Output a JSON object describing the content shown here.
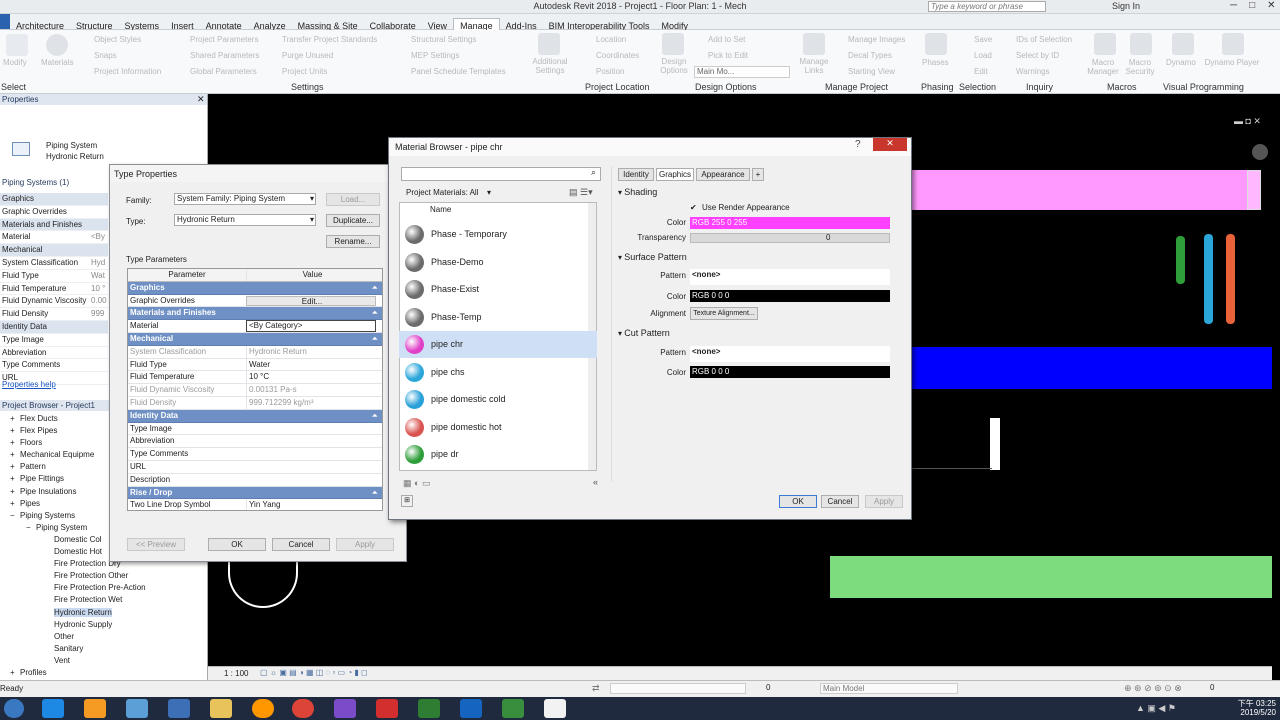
{
  "window": {
    "title": "Autodesk Revit 2018 -   Project1 - Floor Plan: 1 - Mech",
    "search_placeholder": "Type a keyword or phrase",
    "sign_in": "Sign In"
  },
  "ribbon": {
    "tabs": [
      "Architecture",
      "Structure",
      "Systems",
      "Insert",
      "Annotate",
      "Analyze",
      "Massing & Site",
      "Collaborate",
      "View",
      "Manage",
      "Add-Ins",
      "BIM Interoperability Tools",
      "Modify"
    ],
    "active_tab": "Manage",
    "modify_label": "Modify",
    "materials_label": "Materials",
    "settings_items": [
      "Object Styles",
      "Snaps",
      "Project Information",
      "Project Parameters",
      "Shared Parameters",
      "Global Parameters",
      "Transfer Project Standards",
      "Purge Unused",
      "Project Units",
      "Structural Settings",
      "MEP Settings",
      "Panel Schedule Templates"
    ],
    "additional_settings": "Additional Settings",
    "location_items": [
      "Location",
      "Coordinates",
      "Position"
    ],
    "design_options_items": [
      "Add to Set",
      "Pick to Edit",
      "Main Mo..."
    ],
    "design_options_label": "Design Options",
    "manage_project_items": [
      "Manage Images",
      "Decal Types",
      "Starting View"
    ],
    "manage_links": "Manage Links",
    "phases": "Phases",
    "selection_items": [
      "Save",
      "Load",
      "Edit"
    ],
    "inquiry_items": [
      "IDs of Selection",
      "Select by ID",
      "Warnings"
    ],
    "macros_items": [
      "Macro Manager",
      "Macro Security"
    ],
    "dynamo_items": [
      "Dynamo",
      "Dynamo Player"
    ],
    "groups": [
      "Select",
      "Settings",
      "Project Location",
      "Design Options",
      "Manage Project",
      "Phasing",
      "Selection",
      "Inquiry",
      "Macros",
      "Visual Programming"
    ]
  },
  "properties": {
    "header": "Properties",
    "type_line1": "Piping System",
    "type_line2": "Hydronic Return",
    "filter": "Piping Systems (1)",
    "rows": [
      {
        "k": "Graphics",
        "v": "",
        "sec": true
      },
      {
        "k": "Graphic Overrides",
        "v": "",
        "sec": false
      },
      {
        "k": "Materials and Finishes",
        "v": "",
        "sec": true
      },
      {
        "k": "Material",
        "v": "<By",
        "sec": false
      },
      {
        "k": "Mechanical",
        "v": "",
        "sec": true
      },
      {
        "k": "System Classification",
        "v": "Hyd",
        "sec": false
      },
      {
        "k": "Fluid Type",
        "v": "Wat",
        "sec": false
      },
      {
        "k": "Fluid Temperature",
        "v": "10 °",
        "sec": false
      },
      {
        "k": "Fluid Dynamic Viscosity",
        "v": "0.00",
        "sec": false
      },
      {
        "k": "Fluid Density",
        "v": "999",
        "sec": false
      },
      {
        "k": "Identity Data",
        "v": "",
        "sec": true
      },
      {
        "k": "Type Image",
        "v": "",
        "sec": false
      },
      {
        "k": "Abbreviation",
        "v": "",
        "sec": false
      },
      {
        "k": "Type Comments",
        "v": "",
        "sec": false
      },
      {
        "k": "URL",
        "v": "",
        "sec": false
      }
    ],
    "help": "Properties help"
  },
  "project_browser": {
    "header": "Project Browser - Project1",
    "items": [
      {
        "label": "Flex Ducts",
        "level": 1,
        "expander": "+"
      },
      {
        "label": "Flex Pipes",
        "level": 1,
        "expander": "+"
      },
      {
        "label": "Floors",
        "level": 1,
        "expander": "+"
      },
      {
        "label": "Mechanical Equipme",
        "level": 1,
        "expander": "+"
      },
      {
        "label": "Pattern",
        "level": 1,
        "expander": "+"
      },
      {
        "label": "Pipe Fittings",
        "level": 1,
        "expander": "+"
      },
      {
        "label": "Pipe Insulations",
        "level": 1,
        "expander": "+"
      },
      {
        "label": "Pipes",
        "level": 1,
        "expander": "+"
      },
      {
        "label": "Piping Systems",
        "level": 1,
        "expander": "−"
      },
      {
        "label": "Piping System",
        "level": 2,
        "expander": "−"
      },
      {
        "label": "Domestic Col",
        "level": 3,
        "expander": ""
      },
      {
        "label": "Domestic Hot",
        "level": 3,
        "expander": ""
      },
      {
        "label": "Fire Protection Dry",
        "level": 3,
        "expander": ""
      },
      {
        "label": "Fire Protection Other",
        "level": 3,
        "expander": ""
      },
      {
        "label": "Fire Protection Pre-Action",
        "level": 3,
        "expander": ""
      },
      {
        "label": "Fire Protection Wet",
        "level": 3,
        "expander": ""
      },
      {
        "label": "Hydronic Return",
        "level": 3,
        "expander": "",
        "selected": true
      },
      {
        "label": "Hydronic Supply",
        "level": 3,
        "expander": ""
      },
      {
        "label": "Other",
        "level": 3,
        "expander": ""
      },
      {
        "label": "Sanitary",
        "level": 3,
        "expander": ""
      },
      {
        "label": "Vent",
        "level": 3,
        "expander": ""
      },
      {
        "label": "Profiles",
        "level": 1,
        "expander": "+"
      }
    ]
  },
  "type_properties": {
    "title": "Type Properties",
    "family_label": "Family:",
    "family_value": "System Family: Piping System",
    "type_label": "Type:",
    "type_value": "Hydronic Return",
    "load": "Load...",
    "duplicate": "Duplicate...",
    "rename": "Rename...",
    "params_label": "Type Parameters",
    "col_param": "Parameter",
    "col_value": "Value",
    "rows": [
      {
        "k": "Graphics",
        "v": "",
        "kind": "sec"
      },
      {
        "k": "Graphic Overrides",
        "v": "Edit...",
        "kind": "btn"
      },
      {
        "k": "Materials and Finishes",
        "v": "",
        "kind": "sec"
      },
      {
        "k": "Material",
        "v": "<By Category>",
        "kind": "input"
      },
      {
        "k": "Mechanical",
        "v": "",
        "kind": "sec"
      },
      {
        "k": "System Classification",
        "v": "Hydronic Return",
        "kind": "dis"
      },
      {
        "k": "Fluid Type",
        "v": "Water",
        "kind": "n"
      },
      {
        "k": "Fluid Temperature",
        "v": "10 °C",
        "kind": "n"
      },
      {
        "k": "Fluid Dynamic Viscosity",
        "v": "0.00131 Pa-s",
        "kind": "dis"
      },
      {
        "k": "Fluid Density",
        "v": "999.712299 kg/m³",
        "kind": "dis"
      },
      {
        "k": "Identity Data",
        "v": "",
        "kind": "sec"
      },
      {
        "k": "Type Image",
        "v": "",
        "kind": "n"
      },
      {
        "k": "Abbreviation",
        "v": "",
        "kind": "n"
      },
      {
        "k": "Type Comments",
        "v": "",
        "kind": "n"
      },
      {
        "k": "URL",
        "v": "",
        "kind": "n"
      },
      {
        "k": "Description",
        "v": "",
        "kind": "n"
      },
      {
        "k": "Rise / Drop",
        "v": "",
        "kind": "sec"
      },
      {
        "k": "Two Line Drop Symbol",
        "v": "Yin Yang",
        "kind": "n"
      }
    ],
    "preview": "<< Preview",
    "ok": "OK",
    "cancel": "Cancel",
    "apply": "Apply"
  },
  "material_browser": {
    "title": "Material Browser - pipe chr",
    "filter": "Project Materials: All",
    "col_name": "Name",
    "materials": [
      {
        "name": "Phase - Temporary",
        "color": "#6b6b6b"
      },
      {
        "name": "Phase-Demo",
        "color": "#6b6b6b"
      },
      {
        "name": "Phase-Exist",
        "color": "#6b6b6b"
      },
      {
        "name": "Phase-Temp",
        "color": "#6b6b6b"
      },
      {
        "name": "pipe chr",
        "color": "#e040c8",
        "selected": true
      },
      {
        "name": "pipe chs",
        "color": "#2aa6d9"
      },
      {
        "name": "pipe domestic cold",
        "color": "#28a0d8"
      },
      {
        "name": "pipe domestic hot",
        "color": "#d9534f"
      },
      {
        "name": "pipe dr",
        "color": "#2e9e3a"
      }
    ],
    "tabs": [
      "Identity",
      "Graphics",
      "Appearance"
    ],
    "active_tab": "Graphics",
    "add_tab": "+",
    "shading": {
      "title": "Shading",
      "use_render": "Use Render Appearance",
      "color_label": "Color",
      "color_value": "RGB 255 0 255",
      "color_hex": "#ff40ff",
      "transparency_label": "Transparency",
      "transparency_value": "0"
    },
    "surface": {
      "title": "Surface Pattern",
      "pattern_label": "Pattern",
      "pattern_value": "<none>",
      "color_label": "Color",
      "color_value": "RGB 0 0 0",
      "alignment_label": "Alignment",
      "alignment_button": "Texture Alignment..."
    },
    "cut": {
      "title": "Cut Pattern",
      "pattern_label": "Pattern",
      "pattern_value": "<none>",
      "color_label": "Color",
      "color_value": "RGB 0 0 0"
    },
    "ok": "OK",
    "cancel": "Cancel",
    "apply": "Apply"
  },
  "canvas": {
    "scale": "1 : 100",
    "pink_bar": "#ff99ff",
    "blue_bar": "#0000ff",
    "green_bar": "#7ddc7d"
  },
  "status": {
    "left": "Ready",
    "zero1": "0",
    "model": "Main Model",
    "zero2": "0"
  },
  "clock": {
    "time": "下午 03:25",
    "date": "2019/5/20"
  }
}
